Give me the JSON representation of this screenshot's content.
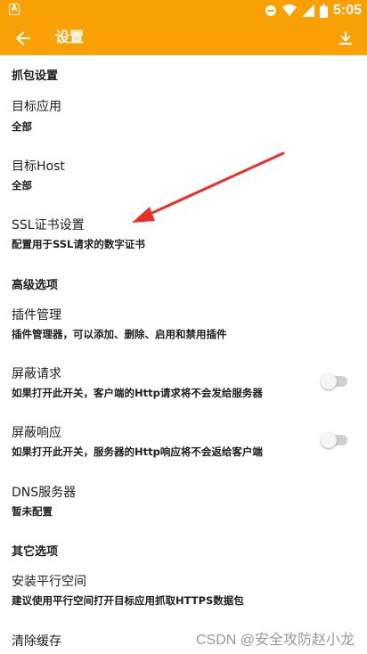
{
  "status_bar": {
    "time": "5:05"
  },
  "app_bar": {
    "title": "设置"
  },
  "sections": [
    {
      "title": "抓包设置"
    },
    {
      "title": "高级选项"
    },
    {
      "title": "其它选项"
    }
  ],
  "items": {
    "target_app": {
      "title": "目标应用",
      "subtitle": "全部"
    },
    "target_host": {
      "title": "目标Host",
      "subtitle": "全部"
    },
    "ssl_cert": {
      "title": "SSL证书设置",
      "subtitle": "配置用于SSL请求的数字证书"
    },
    "plugins": {
      "title": "插件管理",
      "subtitle": "插件管理器，可以添加、删除、启用和禁用插件"
    },
    "block_request": {
      "title": "屏蔽请求",
      "subtitle": "如果打开此开关，客户端的Http请求将不会发给服务器",
      "enabled": false
    },
    "block_response": {
      "title": "屏蔽响应",
      "subtitle": "如果打开此开关，服务器的Http响应将不会返给客户端",
      "enabled": false
    },
    "dns": {
      "title": "DNS服务器",
      "subtitle": "暂未配置"
    },
    "parallel_space": {
      "title": "安装平行空间",
      "subtitle": "建议使用平行空间打开目标应用抓取HTTPS数据包"
    },
    "clear_cache": {
      "title": "清除缓存"
    }
  },
  "watermark": "CSDN @安全攻防赵小龙",
  "colors": {
    "primary": "#f9a004",
    "annotation_arrow": "#e8312a"
  }
}
